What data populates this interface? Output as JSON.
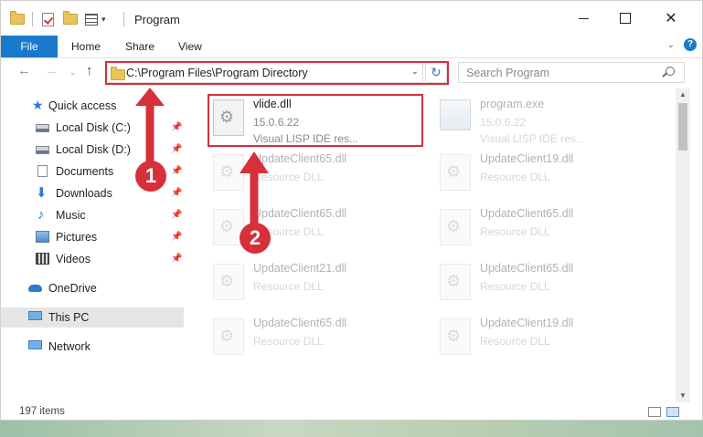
{
  "window": {
    "title": "Program"
  },
  "ribbon": {
    "tabs": [
      "File",
      "Home",
      "Share",
      "View"
    ],
    "help_label": "?"
  },
  "navigation": {
    "address_path": "C:\\Program Files\\Program Directory",
    "search_placeholder": "Search Program"
  },
  "sidebar": {
    "items": [
      {
        "label": "Quick access",
        "icon": "star-icon",
        "pinned": false
      },
      {
        "label": "Local Disk (C:)",
        "icon": "drive-icon",
        "pinned": true
      },
      {
        "label": "Local Disk (D:)",
        "icon": "drive-icon",
        "pinned": true
      },
      {
        "label": "Documents",
        "icon": "documents-icon",
        "pinned": true
      },
      {
        "label": "Downloads",
        "icon": "downloads-icon",
        "pinned": true
      },
      {
        "label": "Music",
        "icon": "music-icon",
        "pinned": true
      },
      {
        "label": "Pictures",
        "icon": "pictures-icon",
        "pinned": true
      },
      {
        "label": "Videos",
        "icon": "videos-icon",
        "pinned": true
      },
      {
        "label": "OneDrive",
        "icon": "onedrive-icon",
        "pinned": false
      },
      {
        "label": "This PC",
        "icon": "this-pc-icon",
        "pinned": false,
        "selected": true
      },
      {
        "label": "Network",
        "icon": "network-icon",
        "pinned": false
      }
    ]
  },
  "files": [
    {
      "name": "vlide.dll",
      "line2": "15.0.6.22",
      "line3": "Visual LISP IDE res...",
      "highlighted": true
    },
    {
      "name": "program.exe",
      "line2": "15.0.6.22",
      "line3": "Visual LISP IDE res..."
    },
    {
      "name": "UpdateClient65.dll",
      "line2": "Resource DLL"
    },
    {
      "name": "UpdateClient19.dll",
      "line2": "Resource DLL"
    },
    {
      "name": "UpdateClient65.dll",
      "line2": "Resource DLL"
    },
    {
      "name": "UpdateClient65.dll",
      "line2": "Resource DLL"
    },
    {
      "name": "UpdateClient21.dll",
      "line2": "Resource DLL"
    },
    {
      "name": "UpdateClient65.dll",
      "line2": "Resource DLL"
    },
    {
      "name": "UpdateClient65.dll",
      "line2": "Resource DLL"
    },
    {
      "name": "UpdateClient19.dll",
      "line2": "Resource DLL"
    }
  ],
  "status": {
    "item_count": "197 items"
  },
  "annotations": {
    "callout_1": "1",
    "callout_2": "2",
    "color": "#d6303b"
  }
}
